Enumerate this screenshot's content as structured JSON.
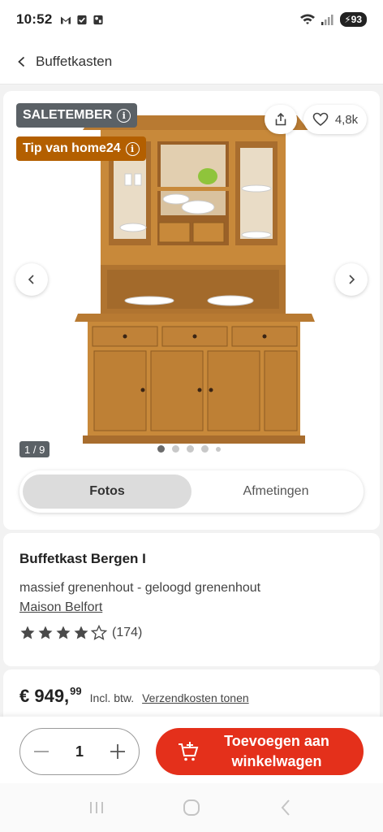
{
  "status_bar": {
    "time": "10:52",
    "battery": "93",
    "network_label": "5"
  },
  "header": {
    "back_label": "Buffetkasten"
  },
  "gallery": {
    "badge_sale": "SALETEMBER",
    "badge_tip": "Tip van home24",
    "likes": "4,8k",
    "counter": "1 / 9",
    "dots_total": 5,
    "active_dot": 0,
    "tabs": [
      {
        "label": "Fotos",
        "active": true
      },
      {
        "label": "Afmetingen",
        "active": false
      }
    ]
  },
  "product": {
    "name": "Buffetkast Bergen I",
    "material": "massief grenenhout - geloogd grenenhout",
    "brand": "Maison Belfort",
    "rating": 4,
    "rating_max": 5,
    "rating_count": "(174)"
  },
  "price": {
    "main": "€ 949,",
    "cents": "99",
    "vat": "Incl. btw.",
    "shipping_link": "Verzendkosten tonen"
  },
  "cart": {
    "quantity": "1",
    "add_button": "Toevoegen aan winkelwagen"
  },
  "colors": {
    "accent": "#e4301b",
    "badge_gray": "#5b6166",
    "badge_tip": "#b35f00",
    "wood": "#c8893a"
  }
}
